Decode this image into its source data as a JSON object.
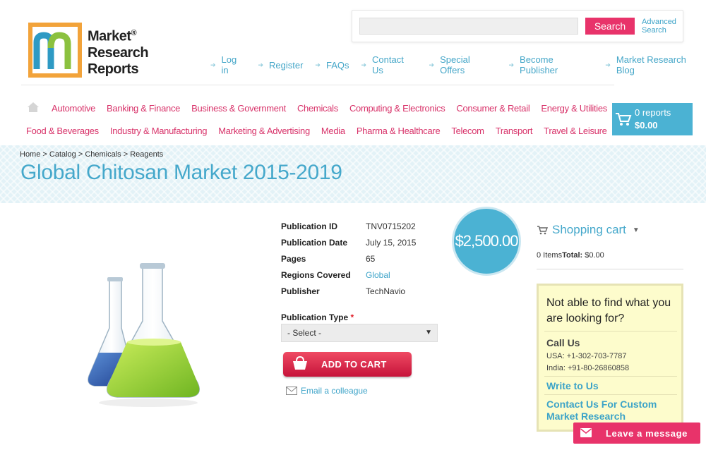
{
  "logo": {
    "line1": "Market",
    "line2": "Research",
    "line3": "Reports",
    "reg": "®"
  },
  "search": {
    "button": "Search",
    "advanced": "Advanced Search",
    "placeholder": ""
  },
  "top_links": [
    "Log in",
    "Register",
    "FAQs",
    "Contact Us",
    "Special Offers",
    "Become Publisher",
    "Market Research Blog"
  ],
  "nav_row1": [
    "Automotive",
    "Banking & Finance",
    "Business & Government",
    "Chemicals",
    "Computing & Electronics",
    "Consumer & Retail",
    "Energy & Utilities"
  ],
  "nav_row2": [
    "Food & Beverages",
    "Industry & Manufacturing",
    "Marketing & Advertising",
    "Media",
    "Pharma & Healthcare",
    "Telecom",
    "Transport",
    "Travel & Leisure"
  ],
  "cart_widget": {
    "reports": "0 reports",
    "total": "$0.00"
  },
  "breadcrumb": "Home > Catalog > Chemicals > Reagents",
  "title": "Global Chitosan Market 2015-2019",
  "details": [
    {
      "label": "Publication ID",
      "value": "TNV0715202"
    },
    {
      "label": "Publication Date",
      "value": "July 15, 2015"
    },
    {
      "label": "Pages",
      "value": "65"
    },
    {
      "label": "Regions Covered",
      "value": "Global"
    },
    {
      "label": "Publisher",
      "value": "TechNavio"
    }
  ],
  "price": "$2,500.00",
  "publication_type": {
    "label": "Publication Type",
    "required": "*",
    "selected": "- Select -"
  },
  "add_to_cart": "ADD TO CART",
  "email_colleague": "Email a colleague",
  "shopping_cart": {
    "title": "Shopping cart",
    "items": "0 Items",
    "total_label": "Total:",
    "total": "$0.00"
  },
  "help": {
    "question": "Not able to find what you are looking for?",
    "call_us": "Call Us",
    "usa": "USA: +1-302-703-7787",
    "india": "India: +91-80-26860858",
    "write": "Write to Us",
    "custom": "Contact Us For Custom Market Research"
  },
  "leave_message": "Leave a message",
  "colors": {
    "accent_pink": "#e8336a",
    "accent_blue": "#4bb2d3",
    "link_blue": "#3ca3c8"
  }
}
